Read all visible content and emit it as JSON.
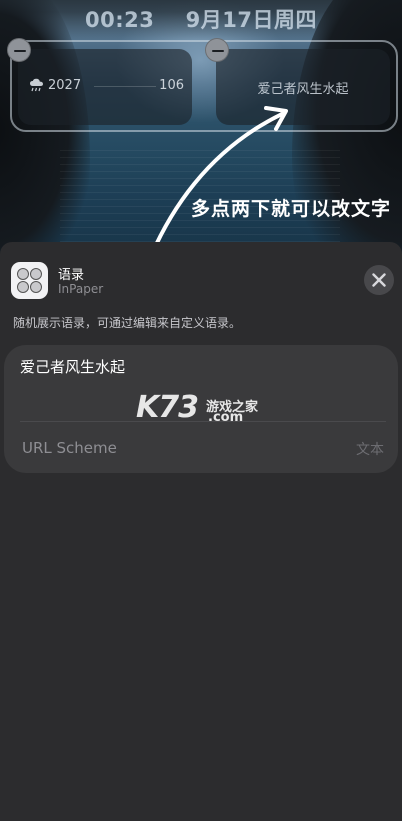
{
  "lock_screen": {
    "time": "00:23",
    "date": "9月17日周四"
  },
  "widgets": {
    "weather": {
      "icon": "rain-cloud-icon",
      "left_value": "2027",
      "right_value": "106"
    },
    "quote": {
      "text": "爱己者风生水起"
    }
  },
  "annotation": {
    "text": "多点两下就可以改文字"
  },
  "sheet": {
    "app_title": "语录",
    "app_subtitle": "InPaper",
    "description": "随机展示语录，可通过编辑来自定义语录。",
    "close_icon": "close-icon",
    "quote_value": "爱己者风生水起",
    "url_scheme_label": "URL Scheme",
    "url_scheme_placeholder": "文本"
  },
  "watermark": {
    "brand": "K73",
    "chinese": "游戏之家",
    "domain": ".com"
  },
  "colors": {
    "sheet_bg": "#2c2c2e",
    "card_bg": "#3a3a3c",
    "secondary_text": "#8e8e93"
  }
}
